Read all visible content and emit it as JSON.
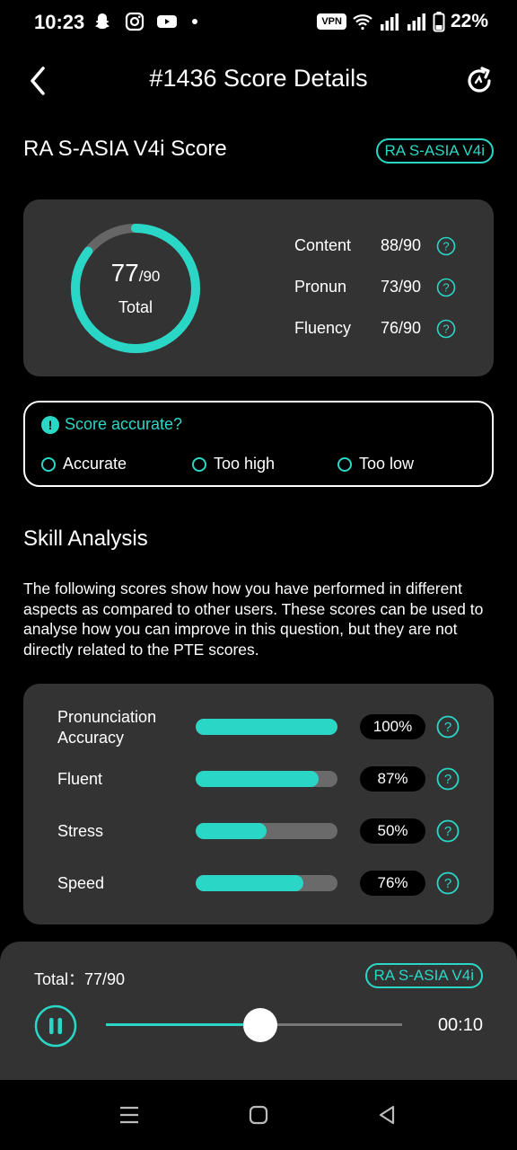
{
  "status_bar": {
    "time": "10:23",
    "vpn": "VPN",
    "battery": "22%",
    "icons": [
      "snapchat-icon",
      "instagram-icon",
      "youtube-icon",
      "dot-icon",
      "wifi-icon",
      "signal-icon",
      "signal-icon",
      "battery-icon"
    ]
  },
  "header": {
    "title": "#1436 Score Details",
    "back_icon": "chevron-left-icon",
    "refresh_icon": "refresh-icon"
  },
  "score_section": {
    "title": "RA S-ASIA V4i Score",
    "tag": "RA S-ASIA V4i",
    "total_value": "77",
    "total_max": "/90",
    "total_label": "Total",
    "total_fraction": 0.8556,
    "metrics": [
      {
        "name": "Content",
        "value": "88/90"
      },
      {
        "name": "Pronun",
        "value": "73/90"
      },
      {
        "name": "Fluency",
        "value": "76/90"
      }
    ]
  },
  "accuracy": {
    "title": "Score accurate?",
    "icon": "!",
    "options": [
      "Accurate",
      "Too high",
      "Too low"
    ]
  },
  "skill": {
    "title": "Skill Analysis",
    "description": "The following scores show how you have performed in different aspects as compared to other users. These scores can be used to analyse how you can improve in this question, but they are not directly related to the PTE scores.",
    "items": [
      {
        "label": "Pronunciation Accuracy",
        "percent": "100%",
        "value": 1.0
      },
      {
        "label": "Fluent",
        "percent": "87%",
        "value": 0.87
      },
      {
        "label": "Stress",
        "percent": "50%",
        "value": 0.5
      },
      {
        "label": "Speed",
        "percent": "76%",
        "value": 0.76
      }
    ]
  },
  "player": {
    "total": "Total：77/90",
    "tag": "RA S-ASIA V4i",
    "time": "00:10",
    "progress": 0.52
  },
  "colors": {
    "accent": "#2ad7c6",
    "card": "#333333",
    "background": "#000000"
  }
}
